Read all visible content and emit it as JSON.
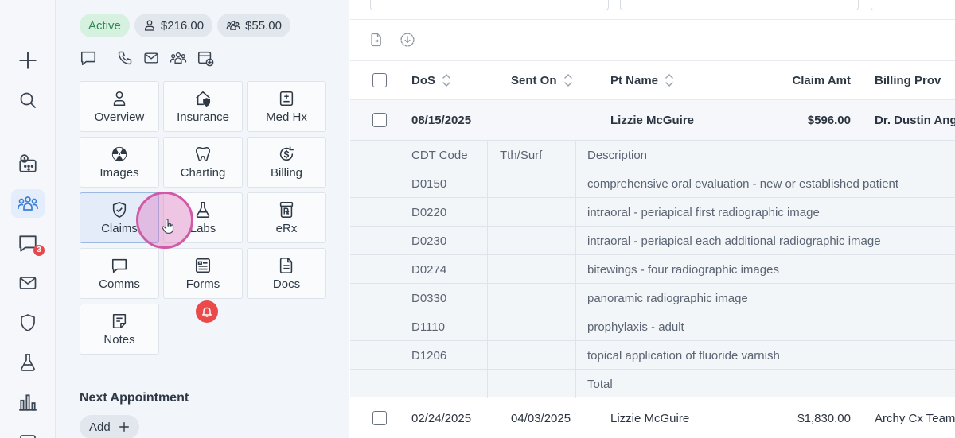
{
  "rail": {
    "chat_badge": "3"
  },
  "patient": {
    "status": "Active",
    "patient_balance": "$216.00",
    "family_balance": "$55.00"
  },
  "tiles": [
    {
      "label": "Overview",
      "icon": "person-icon"
    },
    {
      "label": "Insurance",
      "icon": "insurance-icon"
    },
    {
      "label": "Med Hx",
      "icon": "medical-history-icon"
    },
    {
      "label": "Images",
      "icon": "radiation-icon"
    },
    {
      "label": "Charting",
      "icon": "tooth-icon"
    },
    {
      "label": "Billing",
      "icon": "billing-icon"
    },
    {
      "label": "Claims",
      "icon": "shield-check-icon"
    },
    {
      "label": "Labs",
      "icon": "flask-icon"
    },
    {
      "label": "eRx",
      "icon": "prescription-icon"
    },
    {
      "label": "Comms",
      "icon": "chat-icon"
    },
    {
      "label": "Forms",
      "icon": "form-icon"
    },
    {
      "label": "Docs",
      "icon": "document-icon"
    },
    {
      "label": "Notes",
      "icon": "note-icon"
    }
  ],
  "next_appointment": {
    "title": "Next Appointment",
    "add_label": "Add"
  },
  "table": {
    "columns": [
      "DoS",
      "Sent On",
      "Pt Name",
      "Claim Amt",
      "Billing Prov"
    ],
    "rows": [
      {
        "dos": "08/15/2025",
        "sent_on": "",
        "pt_name": "Lizzie McGuire",
        "claim_amt": "$596.00",
        "billing_prov": "Dr. Dustin Ang"
      },
      {
        "dos": "02/24/2025",
        "sent_on": "04/03/2025",
        "pt_name": "Lizzie McGuire",
        "claim_amt": "$1,830.00",
        "billing_prov": "Archy Cx Team"
      }
    ],
    "sub_columns": [
      "CDT Code",
      "Tth/Surf",
      "Description"
    ],
    "procedures": [
      {
        "code": "D0150",
        "tooth": "",
        "description": "comprehensive oral evaluation - new or established patient"
      },
      {
        "code": "D0220",
        "tooth": "",
        "description": "intraoral - periapical first radiographic image"
      },
      {
        "code": "D0230",
        "tooth": "",
        "description": "intraoral - periapical each additional radiographic image"
      },
      {
        "code": "D0274",
        "tooth": "",
        "description": "bitewings - four radiographic images"
      },
      {
        "code": "D0330",
        "tooth": "",
        "description": "panoramic radiographic image"
      },
      {
        "code": "D1110",
        "tooth": "",
        "description": "prophylaxis - adult"
      },
      {
        "code": "D1206",
        "tooth": "",
        "description": "topical application of fluoride varnish"
      }
    ],
    "total_label": "Total"
  }
}
